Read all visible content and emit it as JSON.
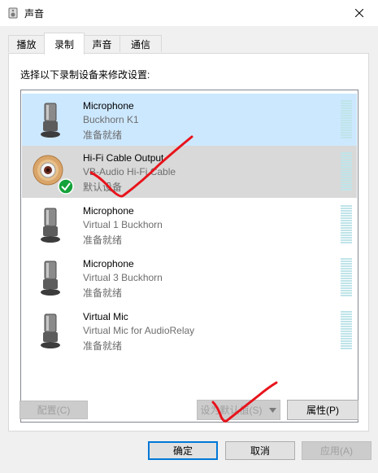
{
  "window": {
    "title": "声音"
  },
  "tabs": [
    {
      "label": "播放"
    },
    {
      "label": "录制"
    },
    {
      "label": "声音"
    },
    {
      "label": "通信"
    }
  ],
  "instruction": "选择以下录制设备来修改设置:",
  "devices": [
    {
      "name": "Microphone",
      "desc": "Buckhorn K1",
      "status": "准备就绪",
      "icon": "microphone-icon"
    },
    {
      "name": "Hi-Fi Cable Output",
      "desc": "VB-Audio Hi-Fi Cable",
      "status": "默认设备",
      "icon": "rca-jack-icon",
      "default": true
    },
    {
      "name": "Microphone",
      "desc": "Virtual 1 Buckhorn",
      "status": "准备就绪",
      "icon": "microphone-icon"
    },
    {
      "name": "Microphone",
      "desc": "Virtual 3 Buckhorn",
      "status": "准备就绪",
      "icon": "microphone-icon"
    },
    {
      "name": "Virtual Mic",
      "desc": "Virtual Mic for AudioRelay",
      "status": "准备就绪",
      "icon": "microphone-icon"
    }
  ],
  "buttons": {
    "configure": "配置(C)",
    "set_default": "设为默认值(S)",
    "properties": "属性(P)",
    "ok": "确定",
    "cancel": "取消",
    "apply": "应用(A)"
  },
  "colors": {
    "selected_highlight": "#cce8ff",
    "default_row": "#d9d9d9",
    "accent": "#0078d7",
    "annotation_red": "#e8131b",
    "default_check": "#15a23a"
  }
}
